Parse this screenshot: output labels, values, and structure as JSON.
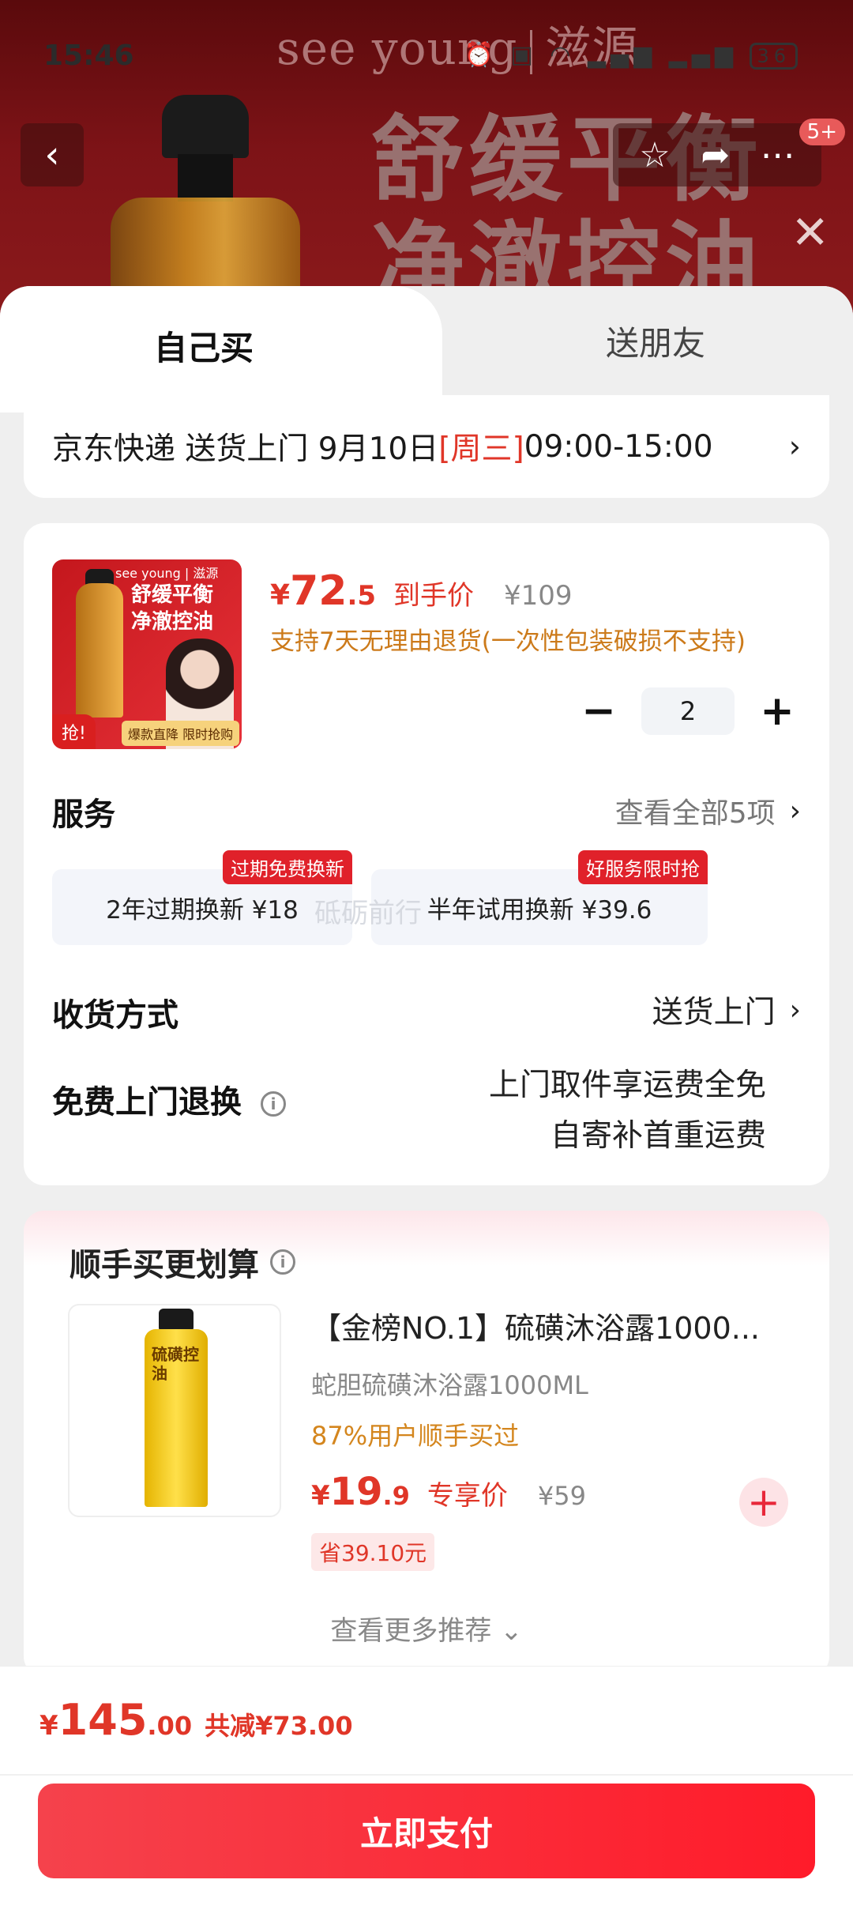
{
  "status": {
    "time": "15:46",
    "battery": "36",
    "icons": "⏰ ▣ ◠ ▂▄▆ ▂▄▆"
  },
  "header": {
    "brand": "see young",
    "brand_cn": "滋源",
    "slogan_line1": "舒缓平衡",
    "slogan_line2": "净澈控油",
    "badge": "5+"
  },
  "tabs": {
    "self": "自己买",
    "friend": "送朋友"
  },
  "delivery": {
    "text_before": "京东快递 送货上门 9月10日 ",
    "day": "[周三]",
    "time": " 09:00-15:00"
  },
  "product": {
    "thumb_brand": "see young | 滋源",
    "thumb_text": "舒缓平衡 净澈控油",
    "thumb_grab": "抢!",
    "thumb_footer": "爆款直降 限时抢购",
    "currency": "¥",
    "price_int": "72",
    "price_dec": ".5",
    "price_tag": "到手价",
    "orig_price": "¥109",
    "return_note": "支持7天无理由退货(一次性包装破损不支持)",
    "qty": "2"
  },
  "service": {
    "title": "服务",
    "view_all": "查看全部5项",
    "items": [
      {
        "label": "2年过期换新  ¥18",
        "flag": "过期免费换新"
      },
      {
        "label": "半年试用换新  ¥39.6",
        "flag": "好服务限时抢"
      }
    ],
    "watermark": "砥砺前行"
  },
  "receive": {
    "title": "收货方式",
    "value": "送货上门"
  },
  "returns": {
    "title": "免费上门退换",
    "line1": "上门取件享运费全免",
    "line2": "自寄补首重运费"
  },
  "reco": {
    "title": "顺手买更划算",
    "name": "【金榜NO.1】硫磺沐浴露1000...",
    "sub": "蛇胆硫磺沐浴露1000ML",
    "percent": "87%用户顺手买过",
    "currency": "¥",
    "price_int": "19",
    "price_dec": ".9",
    "price_tag": "专享价",
    "orig_price": "¥59",
    "save": "省39.10元",
    "thumb_label": "硫磺控油",
    "more": "查看更多推荐 ⌄"
  },
  "bottom": {
    "currency": "¥",
    "total_int": "145",
    "total_dec": ".00",
    "discount": "共减¥73.00",
    "pay": "立即支付"
  }
}
